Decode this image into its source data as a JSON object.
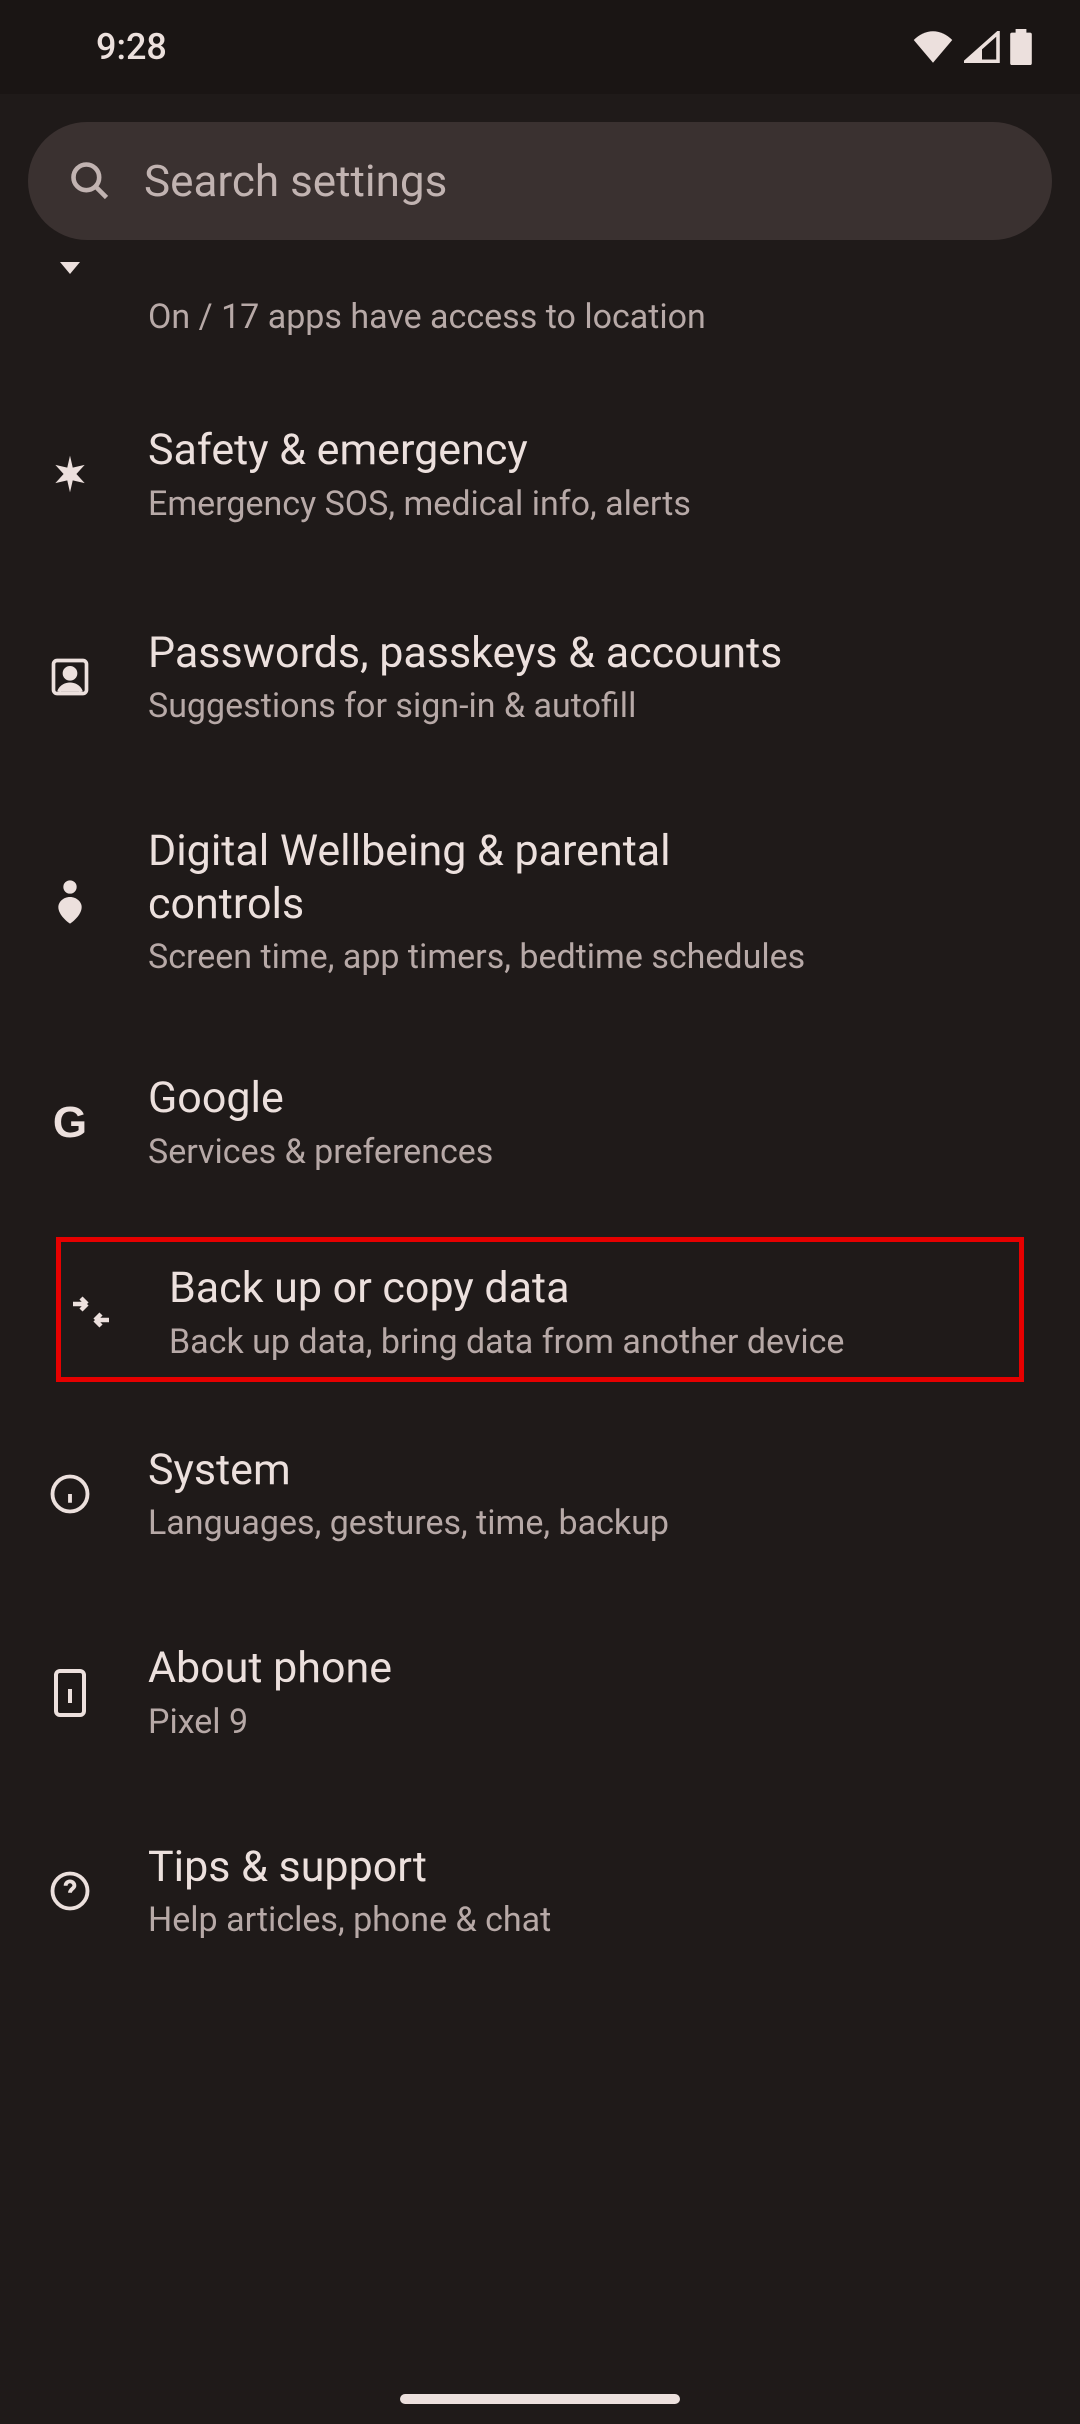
{
  "status": {
    "time": "9:28"
  },
  "search": {
    "placeholder": "Search settings"
  },
  "items": {
    "location_sub": "On / 17 apps have access to location",
    "safety": {
      "title": "Safety & emergency",
      "sub": "Emergency SOS, medical info, alerts"
    },
    "passwords": {
      "title": "Passwords, passkeys & accounts",
      "sub": "Suggestions for sign-in & autofill"
    },
    "wellbeing": {
      "title": "Digital Wellbeing & parental controls",
      "sub": "Screen time, app timers, bedtime schedules"
    },
    "google": {
      "title": "Google",
      "sub": "Services & preferences"
    },
    "backup": {
      "title": "Back up or copy data",
      "sub": "Back up data, bring data from another device"
    },
    "system": {
      "title": "System",
      "sub": "Languages, gestures, time, backup"
    },
    "about": {
      "title": "About phone",
      "sub": "Pixel 9"
    },
    "tips": {
      "title": "Tips & support",
      "sub": "Help articles, phone & chat"
    }
  }
}
